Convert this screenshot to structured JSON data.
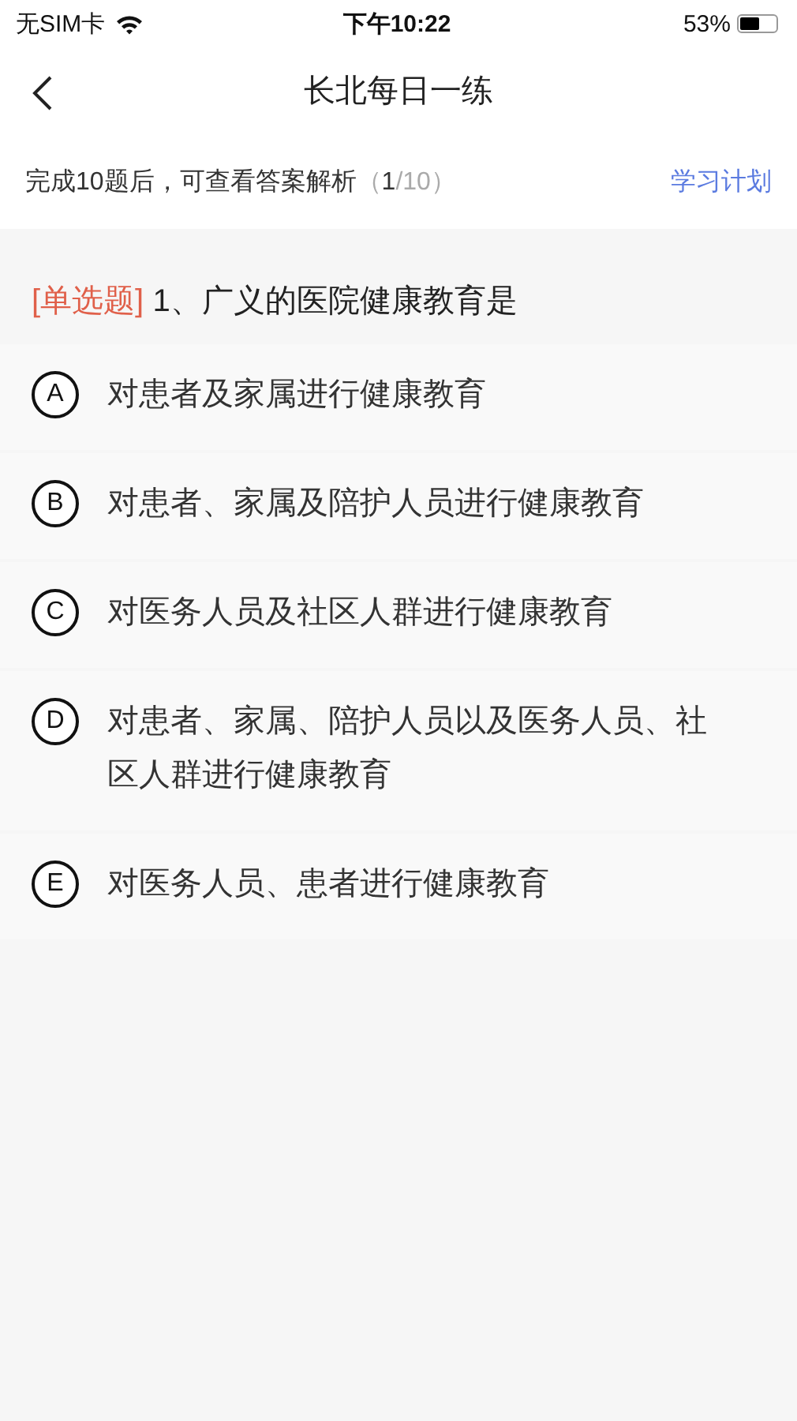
{
  "status_bar": {
    "carrier": "无SIM卡",
    "time": "下午10:22",
    "battery": "53%"
  },
  "nav": {
    "title": "长北每日一练"
  },
  "info_bar": {
    "hint": "完成10题后，可查看答案解析",
    "progress_parts": [
      "（",
      "1",
      "/10）"
    ],
    "plan_link": "学习计划"
  },
  "question": {
    "type_label": "[单选题]",
    "text": "1、广义的医院健康教育是"
  },
  "options": [
    {
      "letter": "A",
      "text": "对患者及家属进行健康教育",
      "selected": false
    },
    {
      "letter": "B",
      "text": "对患者、家属及陪护人员进行健康教育",
      "selected": false
    },
    {
      "letter": "C",
      "text": "对医务人员及社区人群进行健康教育",
      "selected": false
    },
    {
      "letter": "D",
      "text": "对患者、家属、陪护人员以及医务人员、社区人群进行健康教育",
      "selected": false
    },
    {
      "letter": "E",
      "text": "对医务人员、患者进行健康教育",
      "selected": false
    }
  ]
}
